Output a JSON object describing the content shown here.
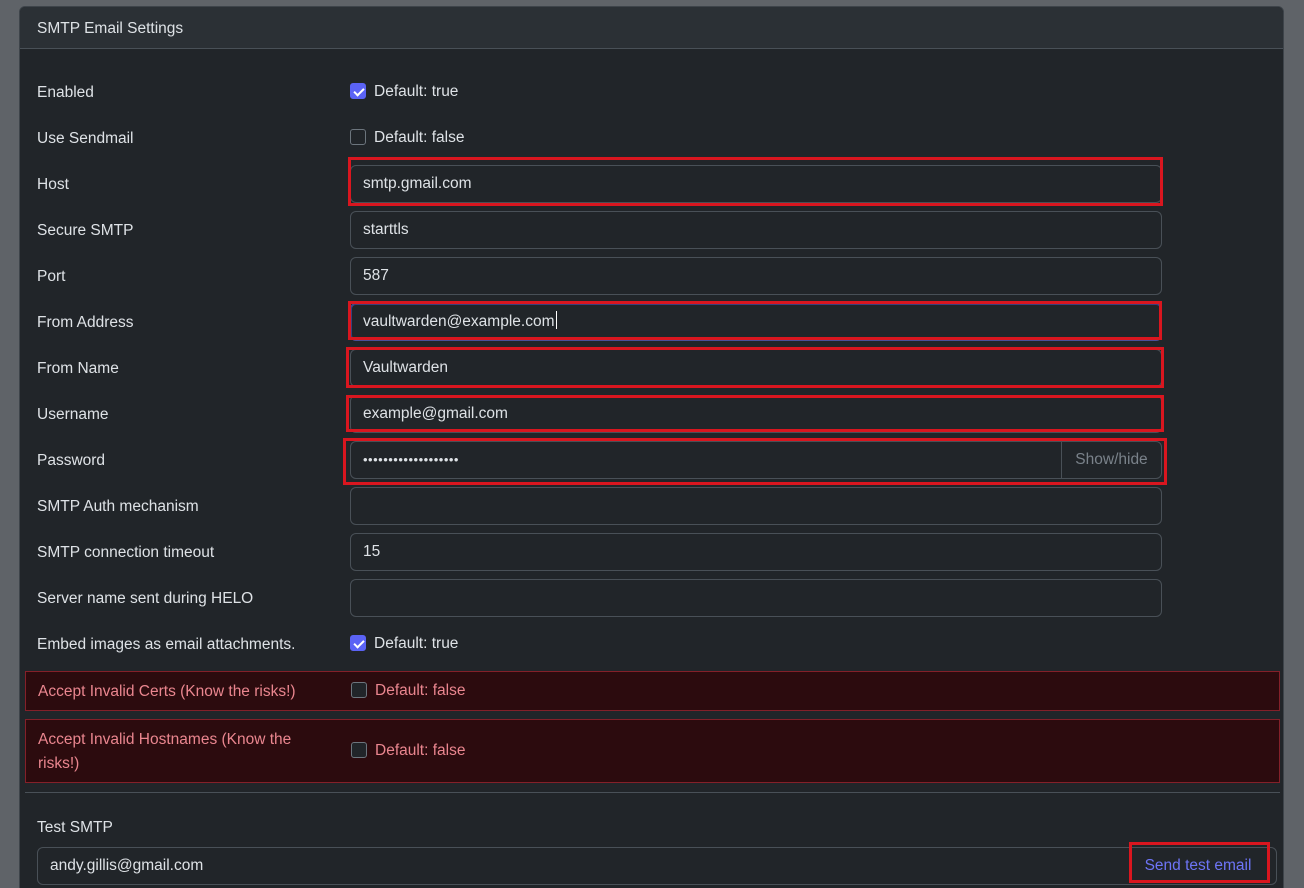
{
  "card": {
    "title": "SMTP Email Settings"
  },
  "fields": {
    "enabled": {
      "label": "Enabled",
      "checked": true,
      "hint": "Default: true"
    },
    "use_sendmail": {
      "label": "Use Sendmail",
      "checked": false,
      "hint": "Default: false"
    },
    "host": {
      "label": "Host",
      "value": "smtp.gmail.com"
    },
    "secure_smtp": {
      "label": "Secure SMTP",
      "value": "starttls"
    },
    "port": {
      "label": "Port",
      "value": "587"
    },
    "from_address": {
      "label": "From Address",
      "value": "vaultwarden@example.com"
    },
    "from_name": {
      "label": "From Name",
      "value": "Vaultwarden"
    },
    "username": {
      "label": "Username",
      "value": "example@gmail.com"
    },
    "password": {
      "label": "Password",
      "value": "•••••••••••••••••••",
      "toggle_label": "Show/hide"
    },
    "auth_mechanism": {
      "label": "SMTP Auth mechanism",
      "value": ""
    },
    "timeout": {
      "label": "SMTP connection timeout",
      "value": "15"
    },
    "helo_name": {
      "label": "Server name sent during HELO",
      "value": ""
    },
    "embed_images": {
      "label": "Embed images as email attachments.",
      "checked": true,
      "hint": "Default: true"
    },
    "accept_invalid_certs": {
      "label": "Accept Invalid Certs (Know the risks!)",
      "checked": false,
      "hint": "Default: false"
    },
    "accept_invalid_hostnames": {
      "label_line1": "Accept Invalid Hostnames (Know the",
      "label_line2": "risks!)",
      "checked": false,
      "hint": "Default: false"
    }
  },
  "test_smtp": {
    "label": "Test SMTP",
    "value": "andy.gillis@gmail.com",
    "button_label": "Send test email"
  },
  "colors": {
    "accent": "#5b63f5",
    "highlight": "#d9161f",
    "danger_text": "#ea868f",
    "danger_bg": "#2c0b0e"
  }
}
